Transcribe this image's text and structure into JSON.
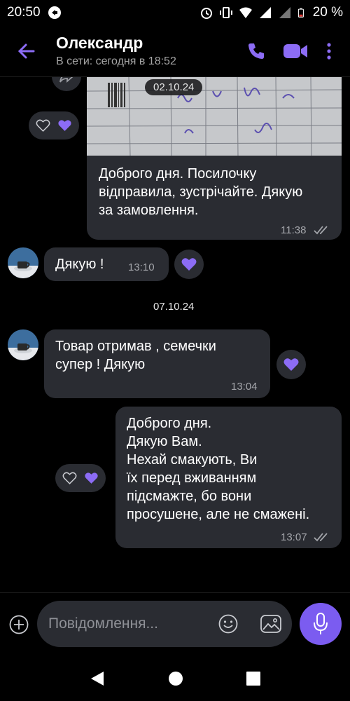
{
  "status_bar": {
    "time": "20:50",
    "battery": "20 %"
  },
  "header": {
    "contact_name": "Олександр",
    "presence": "В сети: сегодня в 18:52"
  },
  "messages": [
    {
      "date_label": "02.10.24",
      "text_lines": [
        "Доброго дня. Посилочку",
        "відправила, зустрічайте. Дякую",
        "за замовлення."
      ],
      "time": "11:38"
    },
    {
      "text": "Дякую !",
      "time": "13:10"
    },
    {
      "date_label": "07.10.24"
    },
    {
      "text_lines": [
        "Товар отримав , семечки",
        "супер ! Дякую"
      ],
      "time": "13:04"
    },
    {
      "text_lines": [
        "Доброго дня.",
        "Дякую Вам.",
        "Нехай смакують, Ви",
        "їх перед вживанням",
        "підсмажте, бо вони",
        "просушене, але не смажені."
      ],
      "time": "13:07"
    }
  ],
  "composer": {
    "placeholder": "Повідомлення..."
  },
  "colors": {
    "accent": "#7b5cf0",
    "bubble": "#2a2c32",
    "background": "#000000"
  },
  "icons": [
    "back-arrow-icon",
    "phone-icon",
    "video-icon",
    "more-icon",
    "plus-icon",
    "emoji-icon",
    "gallery-icon",
    "mic-icon",
    "heart-icon"
  ]
}
